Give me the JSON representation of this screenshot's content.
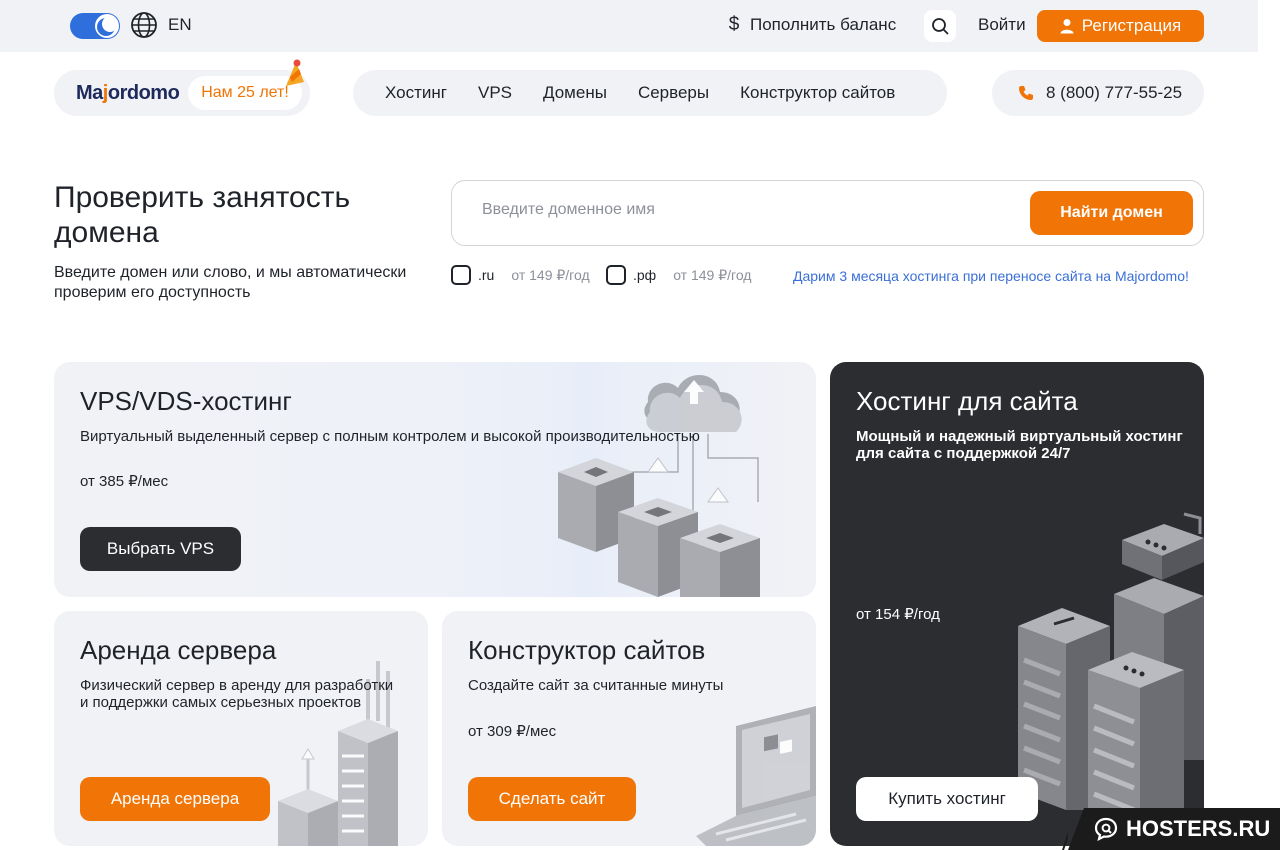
{
  "topbar": {
    "lang": "EN",
    "topup_label": "Пополнить баланс",
    "login_label": "Войти",
    "register_label": "Регистрация"
  },
  "header": {
    "logo_text_pre": "Ma",
    "logo_text_mid": "j",
    "logo_text_post": "ordomo",
    "age_badge": "Нам 25 лет!",
    "nav": [
      "Хостинг",
      "VPS",
      "Домены",
      "Серверы",
      "Конструктор сайтов"
    ],
    "phone": "8 (800) 777-55-25"
  },
  "domain_check": {
    "title": "Проверить занятость домена",
    "subtitle": "Введите домен или слово, и мы автоматически проверим его доступность",
    "placeholder": "Введите доменное имя",
    "button": "Найти домен",
    "zones": [
      {
        "name": ".ru",
        "price": "от 149 ₽/год"
      },
      {
        "name": ".рф",
        "price": "от 149 ₽/год"
      }
    ],
    "promo": "Дарим 3 месяца хостинга при переносе сайта на Majordomo!"
  },
  "cards": {
    "vps": {
      "title": "VPS/VDS-хостинг",
      "desc": "Виртуальный выделенный сервер с полным контролем и высокой производительностью",
      "price": "от 385 ₽/мес",
      "button": "Выбрать VPS"
    },
    "rent": {
      "title": "Аренда сервера",
      "desc": "Физический сервер в аренду для разработки и поддержки самых серьезных проектов",
      "button": "Аренда сервера"
    },
    "builder": {
      "title": "Конструктор сайтов",
      "desc": "Создайте сайт за считанные минуты",
      "price": "от 309 ₽/мес",
      "button": "Сделать сайт"
    },
    "hosting": {
      "title": "Хостинг для сайта",
      "desc": "Мощный и надежный виртуальный хостинг для сайта с поддержкой 24/7",
      "price": "от 154 ₽/год",
      "button": "Купить хостинг"
    }
  },
  "watermark": "HOSTERS.RU",
  "colors": {
    "accent": "#f07406",
    "dark": "#2c2d31",
    "link": "#3a6fd8",
    "toggle": "#2f6fdc"
  }
}
